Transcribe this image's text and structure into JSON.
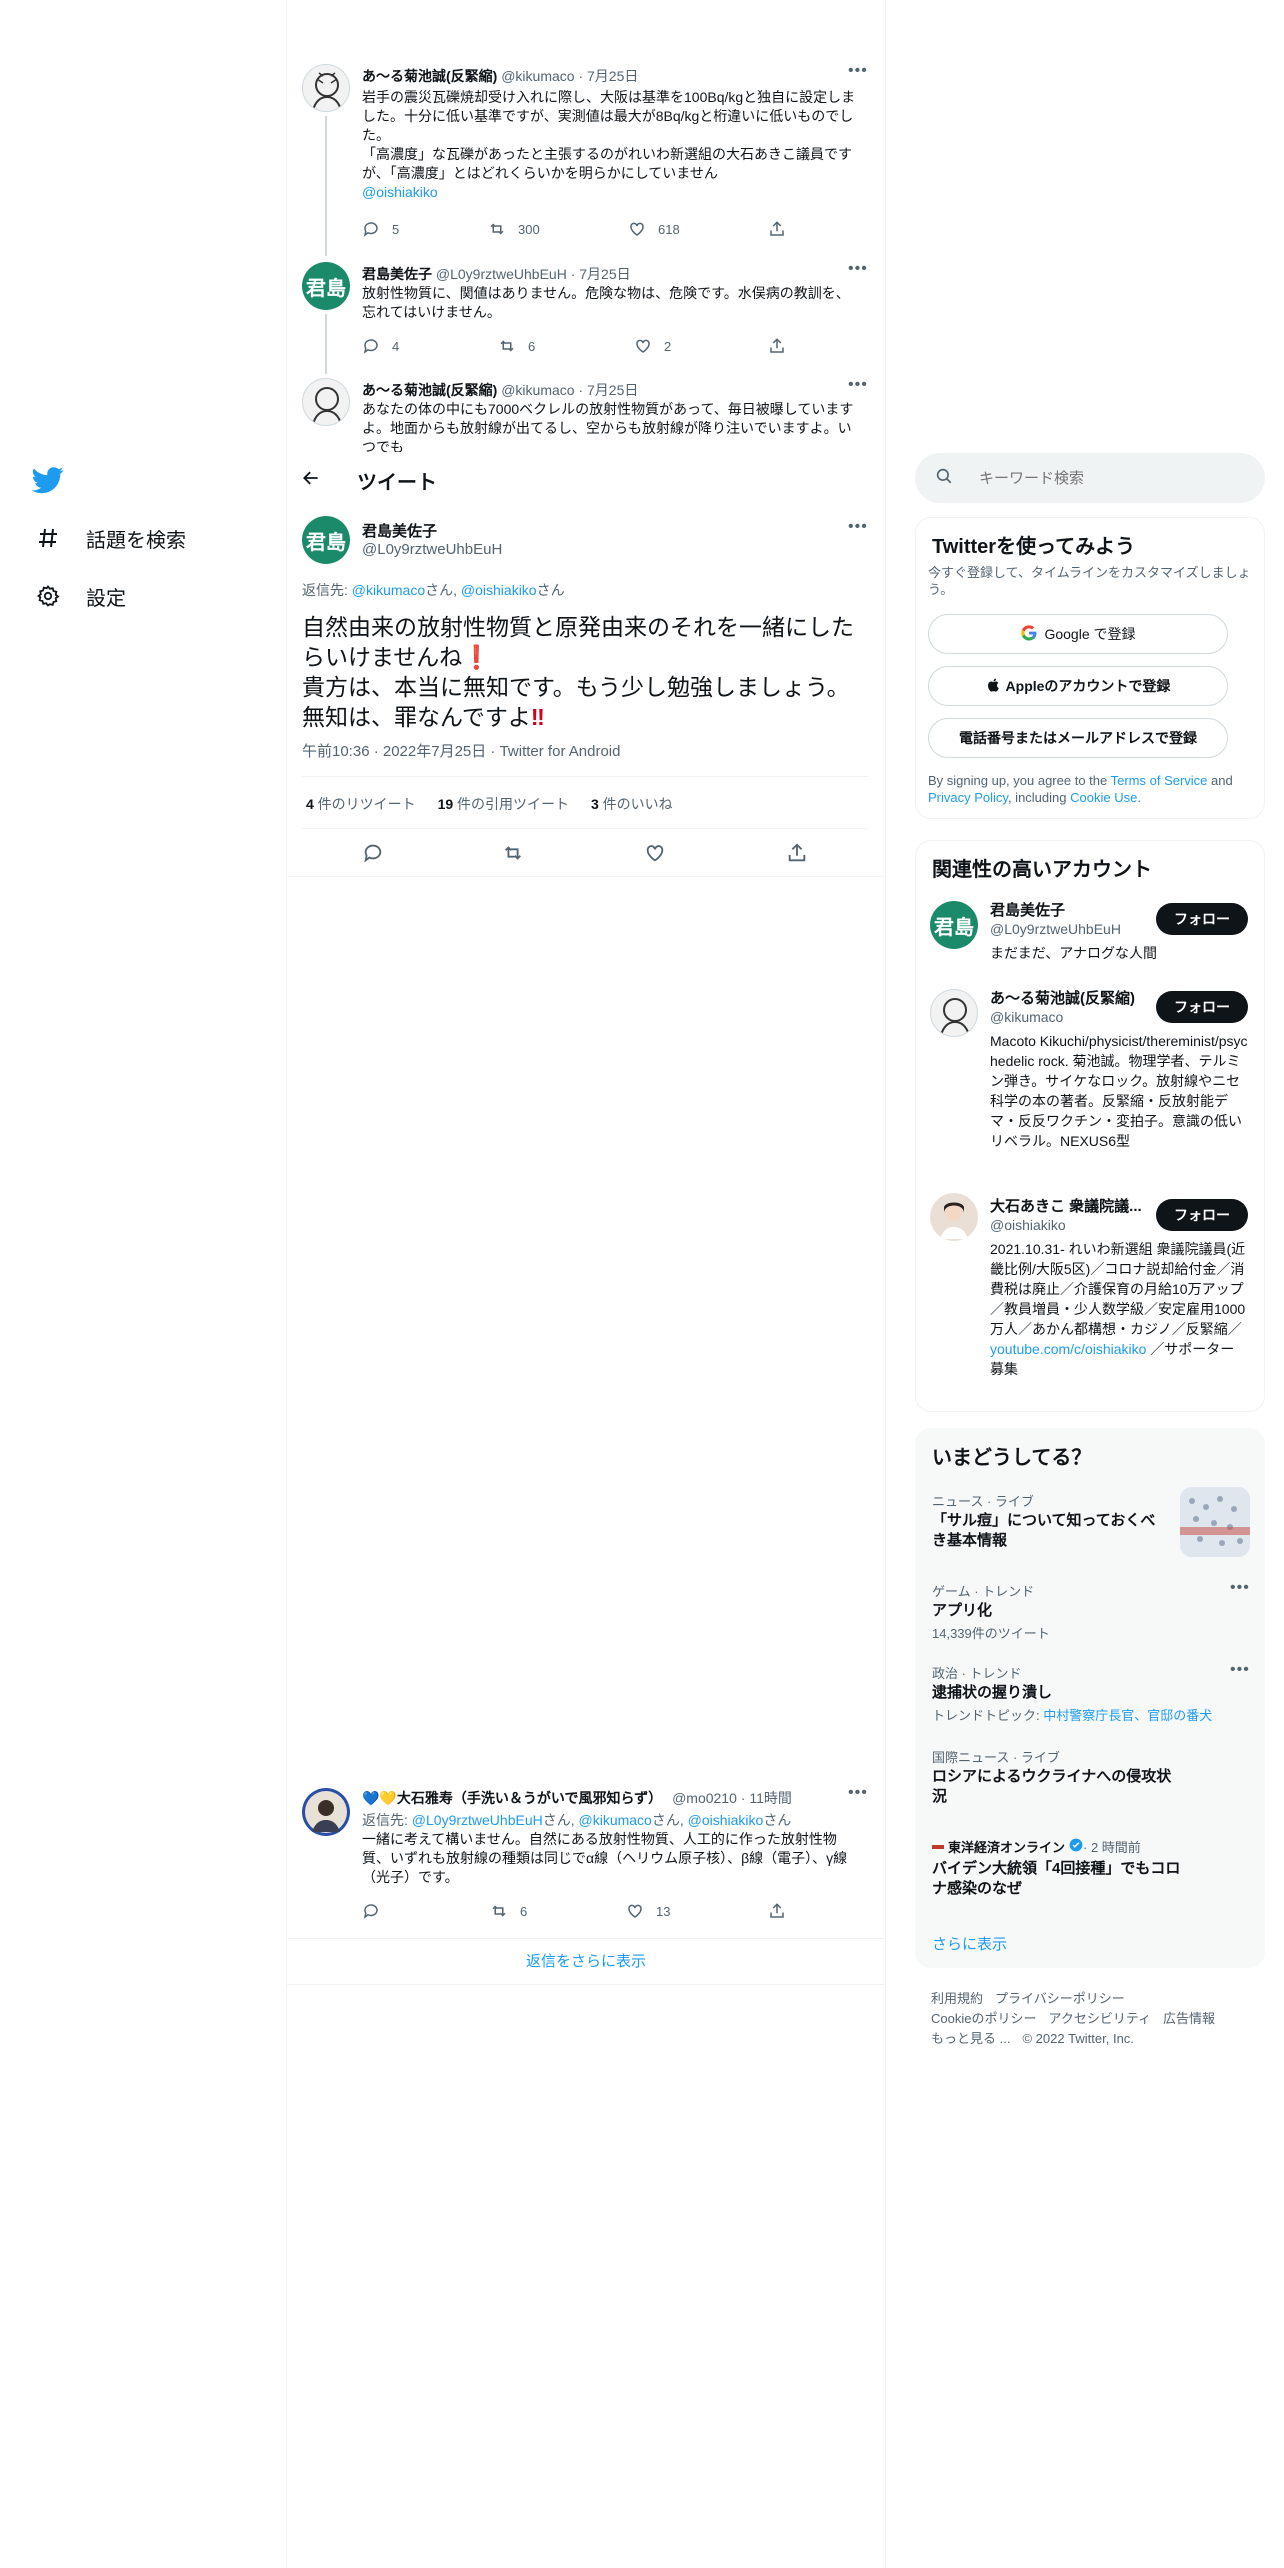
{
  "nav": {
    "explore": "話題を検索",
    "settings": "設定"
  },
  "thread": [
    {
      "name": "あ〜る菊池誠(反緊縮)",
      "handle": "@kikumaco · 7月25日",
      "body": "岩手の震災瓦礫焼却受け入れに際し、大阪は基準を100Bq/kgと独自に設定しました。十分に低い基準ですが、実測値は最大が8Bq/kgと桁違いに低いものでした。\n「高濃度」な瓦礫があったと主張するのがれいわ新選組の大石あきこ議員ですが、「高濃度」とはどれくらいかを明らかにしていません",
      "mention": "@oishiakiko",
      "replies": "5",
      "retweets": "300",
      "likes": "618"
    },
    {
      "name": "君島美佐子",
      "handle": "@L0y9rztweUhbEuH · 7月25日",
      "body": "放射性物質に、関値はありません。危険な物は、危険です。水俣病の教訓を、忘れてはいけません。",
      "replies": "4",
      "retweets": "6",
      "likes": "2"
    },
    {
      "name": "あ〜る菊池誠(反緊縮)",
      "handle": "@kikumaco · 7月25日",
      "body": "あなたの体の中にも7000ベクレルの放射性物質があって、毎日被曝していますよ。地面からも放射線が出てるし、空からも放射線が降り注いでいますよ。いつでも"
    }
  ],
  "header": {
    "title": "ツイート"
  },
  "main": {
    "name": "君島美佐子",
    "handle": "@L0y9rztweUhbEuH",
    "avatar_text": "君島",
    "reply_prefix": "返信先: ",
    "reply_to_1": "@kikumaco",
    "san1": "さん, ",
    "reply_to_2": "@oishiakiko",
    "san2": "さん",
    "line1": "自然由来の放射性物質と原発由来のそれを一緒にしたらいけませんね",
    "line2": "貴方は、本当に無知です。もう少し勉強しましょう。",
    "line3": "無知は、罪なんですよ",
    "meta": "午前10:36 · 2022年7月25日 · Twitter for Android",
    "rt_count": "4",
    "rt_label": " 件のリツイート",
    "qt_count": "19",
    "qt_label": " 件の引用ツイート",
    "like_count": "3",
    "like_label": " 件のいいね"
  },
  "reply": {
    "emoji": "💙💛",
    "name": "大石雅寿（手洗い＆うがいで風邪知らず）",
    "handle": "@mo0210 · 11時間",
    "reply_prefix": "返信先: ",
    "to1": "@L0y9rztweUhbEuH",
    "s1": "さん, ",
    "to2": "@kikumaco",
    "s2": "さん, ",
    "to3": "@oishiakiko",
    "s3": "さん",
    "body": "一緒に考えて構いません。自然にある放射性物質、人工的に作った放射性物質、いずれも放射線の種類は同じでα線（ヘリウム原子核）、β線（電子）、γ線（光子）です。",
    "retweets": "6",
    "likes": "13",
    "more": "返信をさらに表示"
  },
  "search": {
    "placeholder": "キーワード検索"
  },
  "signup": {
    "title": "Twitterを使ってみよう",
    "subtitle": "今すぐ登録して、タイムラインをカスタマイズしましょう。",
    "google": "Google で登録",
    "apple": "Appleのアカウントで登録",
    "phone": "電話番号またはメールアドレスで登録",
    "legal_1": "By signing up, you agree to the ",
    "terms": "Terms of Service",
    "legal_2": " and ",
    "privacy": "Privacy Policy",
    "legal_3": ", including ",
    "cookie": "Cookie Use",
    "legal_4": "."
  },
  "related": {
    "title": "関連性の高いアカウント",
    "follow": "フォロー",
    "accounts": [
      {
        "name": "君島美佐子",
        "handle": "@L0y9rztweUhbEuH",
        "bio": "まだまだ、アナログな人間",
        "avatar_text": "君島"
      },
      {
        "name": "あ〜る菊池誠(反緊縮)",
        "handle": "@kikumaco",
        "bio": "Macoto Kikuchi/physicist/thereminist/psychedelic rock. 菊池誠。物理学者、テルミン弾き。サイケなロック。放射線やニセ科学の本の著者。反緊縮・反放射能デマ・反反ワクチン・変拍子。意識の低いリベラル。NEXUS6型"
      },
      {
        "name": "大石あきこ 衆議院議...",
        "handle": "@oishiakiko",
        "bio": "2021.10.31- れいわ新選組 衆議院議員(近畿比例/大阪5区)／コロナ説却給付金／消費税は廃止／介護保育の月給10万アップ／教員増員・少人数学級／安定雇用1000万人／あかん都構想・カジノ／反緊縮／",
        "bio_link": "youtube.com/c/oishiakiko",
        "bio_tail": " ／サポーター募集"
      }
    ]
  },
  "trends": {
    "title": "いまどうしてる？",
    "items": [
      {
        "context": "ニュース · ライブ",
        "title": "「サル痘」について知っておくべき基本情報"
      },
      {
        "context": "ゲーム · トレンド",
        "title": "アプリ化",
        "sub": "14,339件のツイート"
      },
      {
        "context": "政治 · トレンド",
        "title": "逮捕状の握り潰し",
        "sub_prefix": "トレンドトピック: ",
        "sub_link": "中村警察庁長官、官邸の番犬"
      },
      {
        "context": "国際ニュース · ライブ",
        "title": "ロシアによるウクライナへの侵攻状況"
      },
      {
        "source": "東洋経済オンライン",
        "time": " · 2 時間前",
        "title": "バイデン大統領「4回接種」でもコロナ感染のなぜ"
      }
    ],
    "more": "さらに表示"
  },
  "footer": {
    "l1": [
      "利用規約",
      "プライバシーポリシー"
    ],
    "l2": [
      "Cookieのポリシー",
      "アクセシビリティ",
      "広告情報"
    ],
    "more": "もっと見る ...",
    "copy": "© 2022 Twitter, Inc."
  },
  "colors": {
    "accent": "#1d9bf0",
    "text": "#0f1419",
    "muted": "#536471",
    "border": "#eff3f4"
  }
}
